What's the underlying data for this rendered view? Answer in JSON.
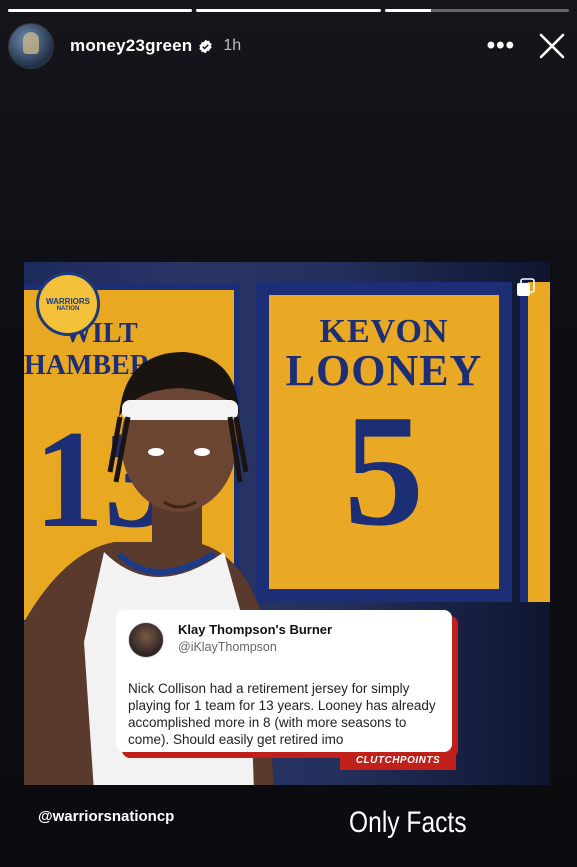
{
  "story": {
    "progress": [
      1,
      1,
      0.25
    ]
  },
  "header": {
    "username": "money23green",
    "time": "1h",
    "more_icon": "more-horizontal-icon",
    "close_icon": "close-icon"
  },
  "post": {
    "banner_left": {
      "first": "WILT",
      "last": "HAMBER",
      "number": "13"
    },
    "banner_main": {
      "first": "KEVON",
      "last": "LOONEY",
      "number": "5"
    },
    "logo": {
      "line1": "WARRIORS",
      "line2": "NATION"
    },
    "tweet": {
      "name": "Klay Thompson's Burner",
      "handle": "@iKlayThompson",
      "body": "Nick Collison had a retirement jersey for simply playing for 1 team for 13 years. Looney has already accomplished more in 8 (with more seasons to come). Should easily get retired imo"
    },
    "watermark": "CLUTCHPOINTS"
  },
  "captions": {
    "mention": "@warriorsnationcp",
    "text": "Only Facts"
  },
  "colors": {
    "gold": "#eaa924",
    "navy": "#1c2e75",
    "red": "#c0201a"
  }
}
